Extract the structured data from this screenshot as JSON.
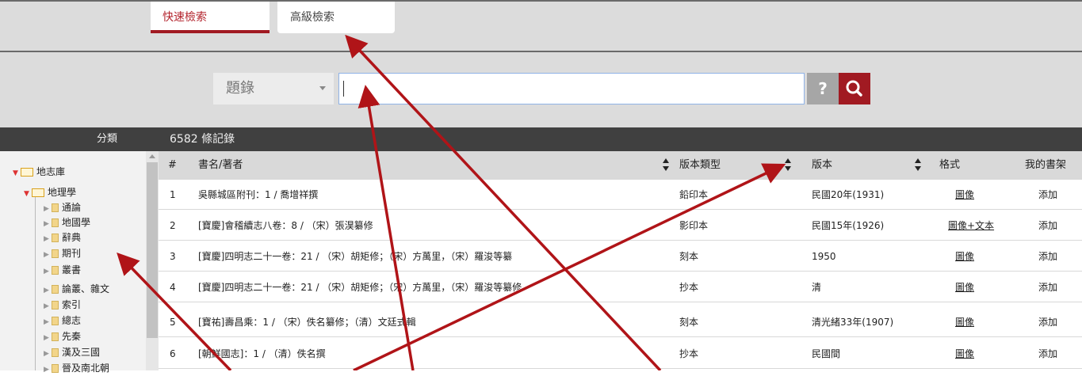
{
  "tabs": {
    "quick": "快速檢索",
    "advanced": "高級檢索"
  },
  "search": {
    "field": "題錄",
    "value": "",
    "help": "?"
  },
  "bar": {
    "category": "分類",
    "records": "6582 條記錄"
  },
  "tree": [
    {
      "label": "地志庫",
      "level": 0
    },
    {
      "label": "地理學",
      "level": 1
    },
    {
      "label": "通論",
      "level": 2
    },
    {
      "label": "地國學",
      "level": 2
    },
    {
      "label": "辭典",
      "level": 2
    },
    {
      "label": "期刊",
      "level": 2
    },
    {
      "label": "叢書",
      "level": 2
    },
    {
      "label": "論叢、雜文",
      "level": 2
    },
    {
      "label": "索引",
      "level": 2
    },
    {
      "label": "總志",
      "level": 2
    },
    {
      "label": "先秦",
      "level": 2
    },
    {
      "label": "漢及三國",
      "level": 2
    },
    {
      "label": "晉及南北朝",
      "level": 2
    }
  ],
  "columns": {
    "num": "#",
    "title": "書名/著者",
    "type": "版本類型",
    "edition": "版本",
    "format": "格式",
    "shelf": "我的書架"
  },
  "rows": [
    {
      "num": "1",
      "title": "吳縣城區附刊：1 / 喬增祥撰",
      "type": "鉛印本",
      "edition": "民國20年(1931)",
      "format": "圖像",
      "shelf": "添加"
    },
    {
      "num": "2",
      "title": "[寶慶]會稽續志八卷：8 / （宋）張淏纂修",
      "type": "影印本",
      "edition": "民國15年(1926)",
      "format": "圖像+文本",
      "shelf": "添加"
    },
    {
      "num": "3",
      "title": "[寶慶]四明志二十一卷：21 / （宋）胡矩修；（宋）方萬里，（宋）羅浚等纂",
      "type": "刻本",
      "edition": "1950",
      "format": "圖像",
      "shelf": "添加"
    },
    {
      "num": "4",
      "title": "[寶慶]四明志二十一卷：21 / （宋）胡矩修；（宋）方萬里，（宋）羅浚等纂修",
      "type": "抄本",
      "edition": "清",
      "format": "圖像",
      "shelf": "添加"
    },
    {
      "num": "5",
      "title": "[寶祐]壽昌乘：1 / （宋）佚名纂修；（清）文廷式輯",
      "type": "刻本",
      "edition": "清光緒33年(1907)",
      "format": "圖像",
      "shelf": "添加"
    },
    {
      "num": "6",
      "title": "[朝鮮國志]：1 / （清）佚名撰",
      "type": "抄本",
      "edition": "民國間",
      "format": "圖像",
      "shelf": "添加"
    }
  ],
  "colors": {
    "accent": "#a11a22",
    "arrow": "#b01418"
  }
}
